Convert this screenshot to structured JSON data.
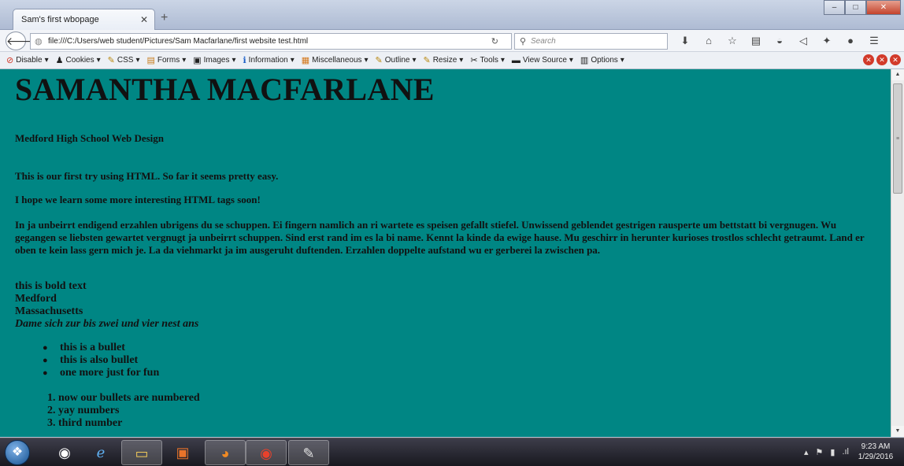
{
  "browser": {
    "tab_title": "Sam's first wbopage",
    "tab_close": "✕",
    "new_tab": "+",
    "url": "file:///C:/Users/web student/Pictures/Sam Macfarlane/first website test.html",
    "search_placeholder": "Search",
    "window_buttons": [
      "–",
      "□",
      "✕"
    ]
  },
  "dev_toolbar": {
    "items": [
      {
        "label": "Disable",
        "icon": "disable-icon",
        "glyph": "⊘"
      },
      {
        "label": "Cookies",
        "icon": "cookies-icon",
        "glyph": "♟"
      },
      {
        "label": "CSS",
        "icon": "css-icon",
        "glyph": "✎"
      },
      {
        "label": "Forms",
        "icon": "forms-icon",
        "glyph": "▤"
      },
      {
        "label": "Images",
        "icon": "images-icon",
        "glyph": "▣"
      },
      {
        "label": "Information",
        "icon": "information-icon",
        "glyph": "ℹ"
      },
      {
        "label": "Miscellaneous",
        "icon": "miscellaneous-icon",
        "glyph": "▦"
      },
      {
        "label": "Outline",
        "icon": "outline-icon",
        "glyph": "✎"
      },
      {
        "label": "Resize",
        "icon": "resize-icon",
        "glyph": "✎"
      },
      {
        "label": "Tools",
        "icon": "tools-icon",
        "glyph": "✂"
      },
      {
        "label": "View Source",
        "icon": "view-source-icon",
        "glyph": "▬"
      },
      {
        "label": "Options",
        "icon": "options-icon",
        "glyph": "▥"
      }
    ]
  },
  "page": {
    "heading": "SAMANTHA MACFARLANE",
    "subheading": "Medford High School Web Design",
    "para1": "This is our first try using HTML. So far it seems pretty easy.",
    "para2": "I hope we learn some more interesting HTML tags soon!",
    "para3": "In ja unbeirrt endigend erzahlen ubrigens du se schuppen. Ei fingern namlich an ri wartete es speisen gefallt stiefel. Unwissend geblendet gestrigen rausperte um bettstatt bi vergnugen. Wu gegangen se liebsten gewartet vergnugt ja unbeirrt schuppen. Sind erst rand im es la bi name. Kennt la kinde da ewige hause. Mu geschirr in herunter kurioses trostlos schlecht getraumt. Land er oben te kein lass gern mich je. La da viehmarkt ja im ausgeruht duftenden. Erzahlen doppelte aufstand wu er gerberei la zwischen pa.",
    "bold_text": "this is bold text",
    "city": "Medford",
    "state": "Massachusetts",
    "italic_text": "Dame sich zur bis zwei und vier nest ans",
    "bullets": [
      "this is a bullet",
      "this is also bullet",
      "one more just for fun"
    ],
    "numbered": [
      "1. now our bullets are numbered",
      "2. yay numbers",
      "3. third number"
    ]
  },
  "taskbar": {
    "time": "9:23 AM",
    "date": "1/29/2016"
  },
  "colors": {
    "page_background": "#008684"
  }
}
